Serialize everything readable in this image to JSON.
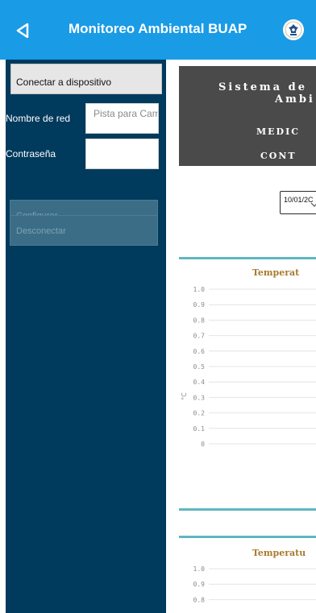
{
  "header": {
    "title": "Monitoreo Ambiental BUAP",
    "background": "#1a9be6"
  },
  "sidebar": {
    "connect_button": "Conectar a dispositivo",
    "network_label": "Nombre de red",
    "network_placeholder": "Pista para Cam",
    "password_label": "Contraseña",
    "password_value": "",
    "configure_button": "Configurar",
    "disconnect_button": "Desconectar",
    "background": "#003a5c"
  },
  "main": {
    "banner": {
      "title_line1": "Sistema de",
      "title_line2": "Ambi",
      "subtitle_line1": "MEDIC",
      "subtitle_line2": "CONT"
    },
    "date_value": "10/01/2C",
    "charts": [
      {
        "title": "Temperat",
        "unit": "°C",
        "ticks": [
          "1.0",
          "0.9",
          "0.8",
          "0.7",
          "0.6",
          "0.5",
          "0.4",
          "0.3",
          "0.2",
          "0.1",
          "0"
        ]
      },
      {
        "title": "Temperatu",
        "ticks": [
          "1.0",
          "0.9",
          "0.8"
        ]
      }
    ]
  },
  "colors": {
    "accent": "#5fb7c1",
    "chart_title": "#a87a2d",
    "banner_bg": "#4a4a4a",
    "disabled_button": "#3b6d86"
  }
}
